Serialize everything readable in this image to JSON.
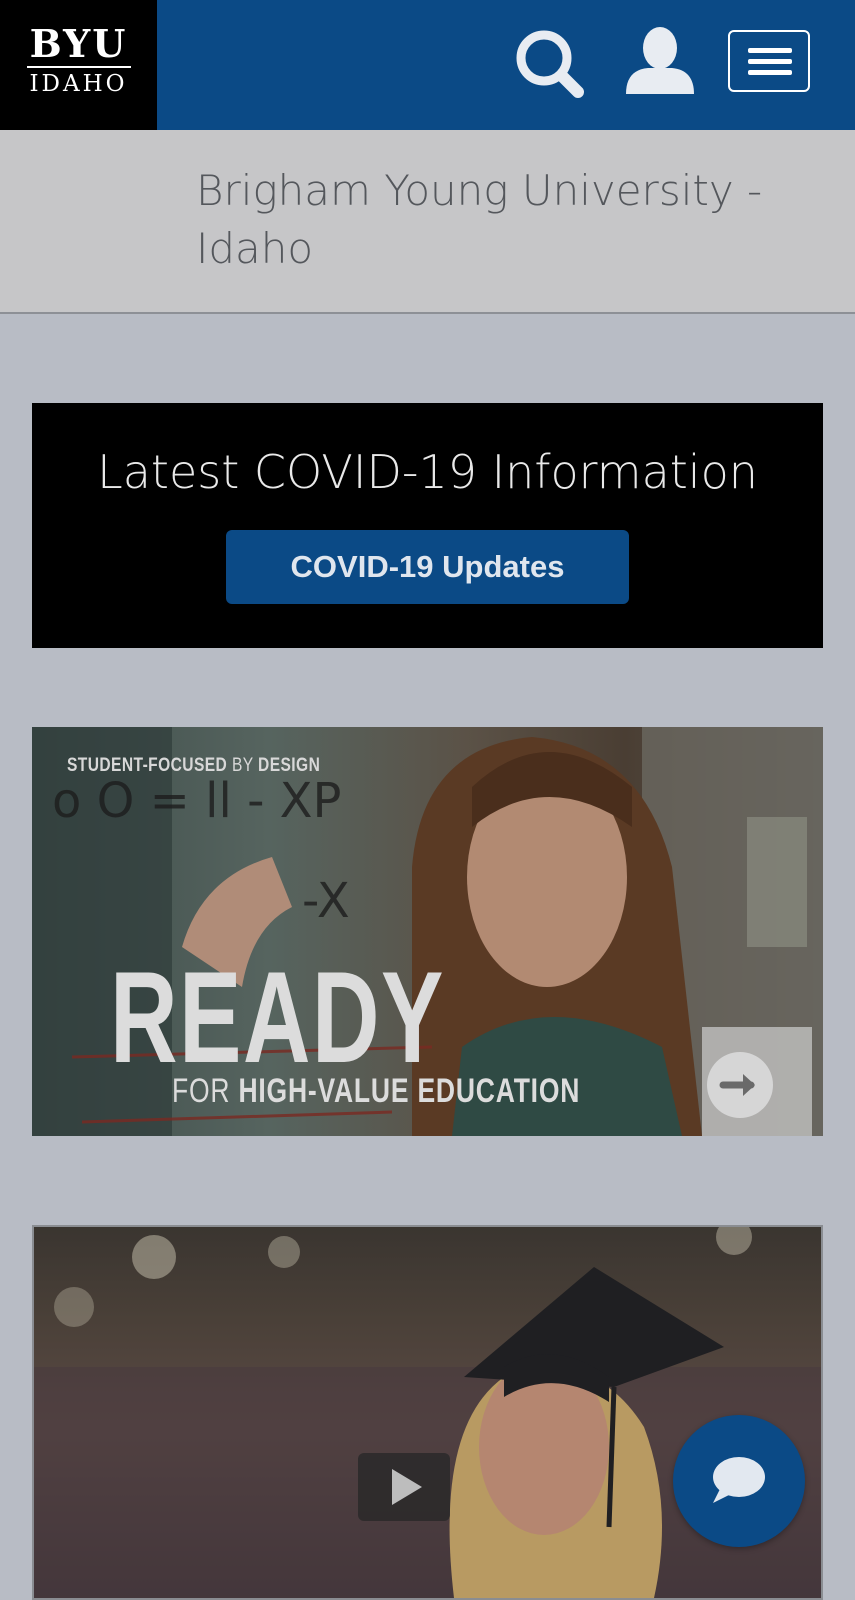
{
  "header": {
    "logo": {
      "line1": "BYU",
      "line2": "IDAHO"
    },
    "icons": {
      "search": "search-icon",
      "account": "user-icon",
      "menu": "hamburger-menu-icon"
    }
  },
  "site_title": "Brigham Young University - Idaho",
  "covid": {
    "heading": "Latest COVID-19 Information",
    "button_label": "COVID-19 Updates"
  },
  "banner_ready": {
    "kicker_part1": "STUDENT-FOCUSED",
    "kicker_part2": " BY ",
    "kicker_part3": "DESIGN",
    "headline": "READY",
    "sub_part1": "FOR ",
    "sub_part2": "HIGH-VALUE EDUCATION",
    "icon": "arrow-right-icon"
  },
  "banner_video": {
    "icon": "play-icon"
  },
  "chat": {
    "icon": "chat-bubble-icon"
  },
  "colors": {
    "brand_blue": "#0b4a86",
    "overlay_gray": "#b8bcc5",
    "black": "#000000"
  }
}
